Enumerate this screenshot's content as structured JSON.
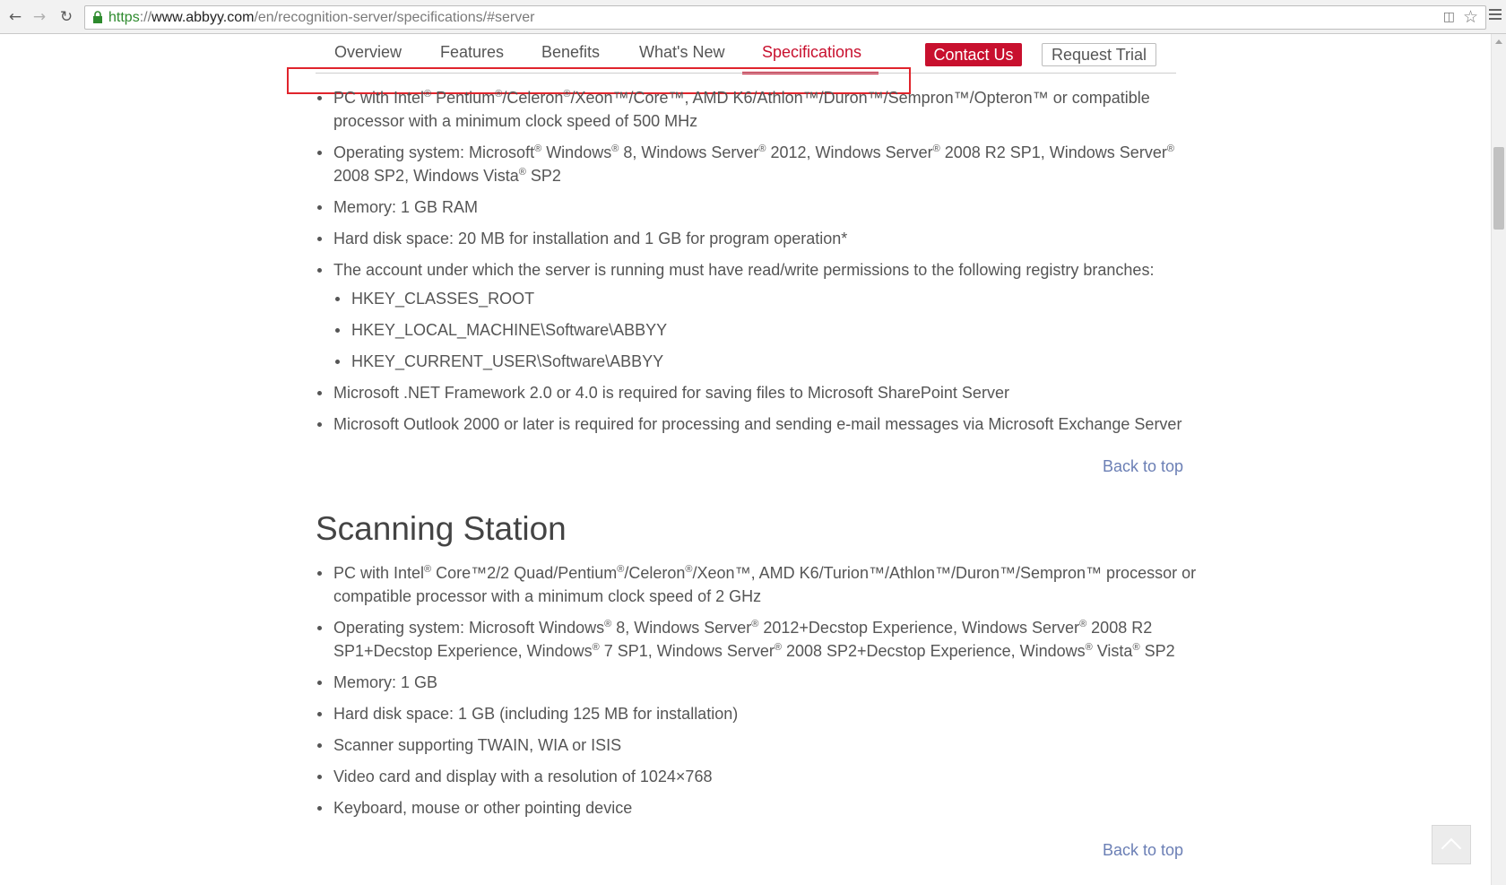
{
  "browser": {
    "url_secure": "https",
    "url_separator": "://",
    "url_host": "www.abbyy.com",
    "url_path": "/en/recognition-server/specifications/#server",
    "icons": [
      "back-arrow-icon",
      "forward-arrow-icon",
      "reload-icon",
      "lock-icon",
      "translate-icon",
      "star-icon",
      "menu-icon"
    ]
  },
  "subnav": {
    "tabs": [
      {
        "label": "Overview"
      },
      {
        "label": "Features"
      },
      {
        "label": "Benefits"
      },
      {
        "label": "What's New"
      },
      {
        "label": "Specifications"
      }
    ],
    "active_tab": "Specifications",
    "contact_label": "Contact Us",
    "trial_label": "Request Trial"
  },
  "server": {
    "items": [
      "PC with Intel® Pentium®/Celeron®/Xeon™/Core™, AMD K6/Athlon™/Duron™/Sempron™/Opteron™ or compatible processor with a minimum clock speed of 500 MHz",
      "Operating system: Microsoft® Windows® 8, Windows Server® 2012, Windows Server® 2008 R2 SP1, Windows Server® 2008 SP2, Windows Vista® SP2",
      "Memory: 1 GB RAM",
      "Hard disk space: 20 MB for installation and 1 GB for program operation*",
      "The account under which the server is running must have read/write permissions to the following registry branches:",
      "Microsoft .NET Framework 2.0 or 4.0 is required for saving files to Microsoft SharePoint Server",
      "Microsoft Outlook 2000 or later is required for processing and sending e-mail messages via Microsoft Exchange Server"
    ],
    "registry": [
      "HKEY_CLASSES_ROOT",
      "HKEY_LOCAL_MACHINE\\Software\\ABBYY",
      "HKEY_CURRENT_USER\\Software\\ABBYY"
    ],
    "back_to_top": "Back to top"
  },
  "scanning": {
    "title": "Scanning Station",
    "items": [
      "PC with Intel® Core™2/2 Quad/Pentium®/Celeron®/Xeon™, AMD K6/Turion™/Athlon™/Duron™/Sempron™ processor or compatible processor with a minimum clock speed of 2 GHz",
      "Operating system: Microsoft Windows® 8, Windows Server® 2012+Decstop Experience, Windows Server® 2008 R2 SP1+Decstop Experience, Windows® 7 SP1, Windows Server® 2008 SP2+Decstop Experience, Windows® Vista® SP2",
      "Memory: 1 GB",
      "Hard disk space: 1 GB (including 125 MB for installation)",
      "Scanner supporting TWAIN, WIA or ISIS",
      "Video card and display with a resolution of 1024×768",
      "Keyboard, mouse or other pointing device"
    ],
    "back_to_top": "Back to top"
  },
  "colors": {
    "brand_red": "#c8102e",
    "link_blue": "#6b7fb5",
    "annotation_red": "#e0242c"
  }
}
